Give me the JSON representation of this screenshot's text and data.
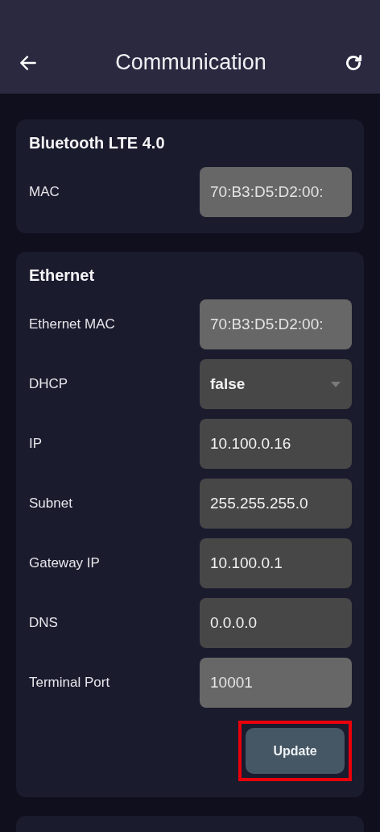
{
  "header": {
    "title": "Communication"
  },
  "sections": [
    {
      "title": "Bluetooth LTE 4.0",
      "fields": [
        {
          "kind": "text",
          "label": "MAC",
          "value": "70:B3:D5:D2:00:",
          "disabled": true
        }
      ]
    },
    {
      "title": "Ethernet",
      "fields": [
        {
          "kind": "text",
          "label": "Ethernet MAC",
          "value": "70:B3:D5:D2:00:",
          "disabled": true
        },
        {
          "kind": "select",
          "label": "DHCP",
          "value": "false",
          "disabled": false
        },
        {
          "kind": "text",
          "label": "IP",
          "value": "10.100.0.16",
          "disabled": false
        },
        {
          "kind": "text",
          "label": "Subnet",
          "value": "255.255.255.0",
          "disabled": false
        },
        {
          "kind": "text",
          "label": "Gateway IP",
          "value": "10.100.0.1",
          "disabled": false
        },
        {
          "kind": "text",
          "label": "DNS",
          "value": "0.0.0.0",
          "disabled": false
        },
        {
          "kind": "text",
          "label": "Terminal Port",
          "value": "10001",
          "disabled": true
        }
      ],
      "button": {
        "label": "Update",
        "highlighted": true
      }
    }
  ]
}
